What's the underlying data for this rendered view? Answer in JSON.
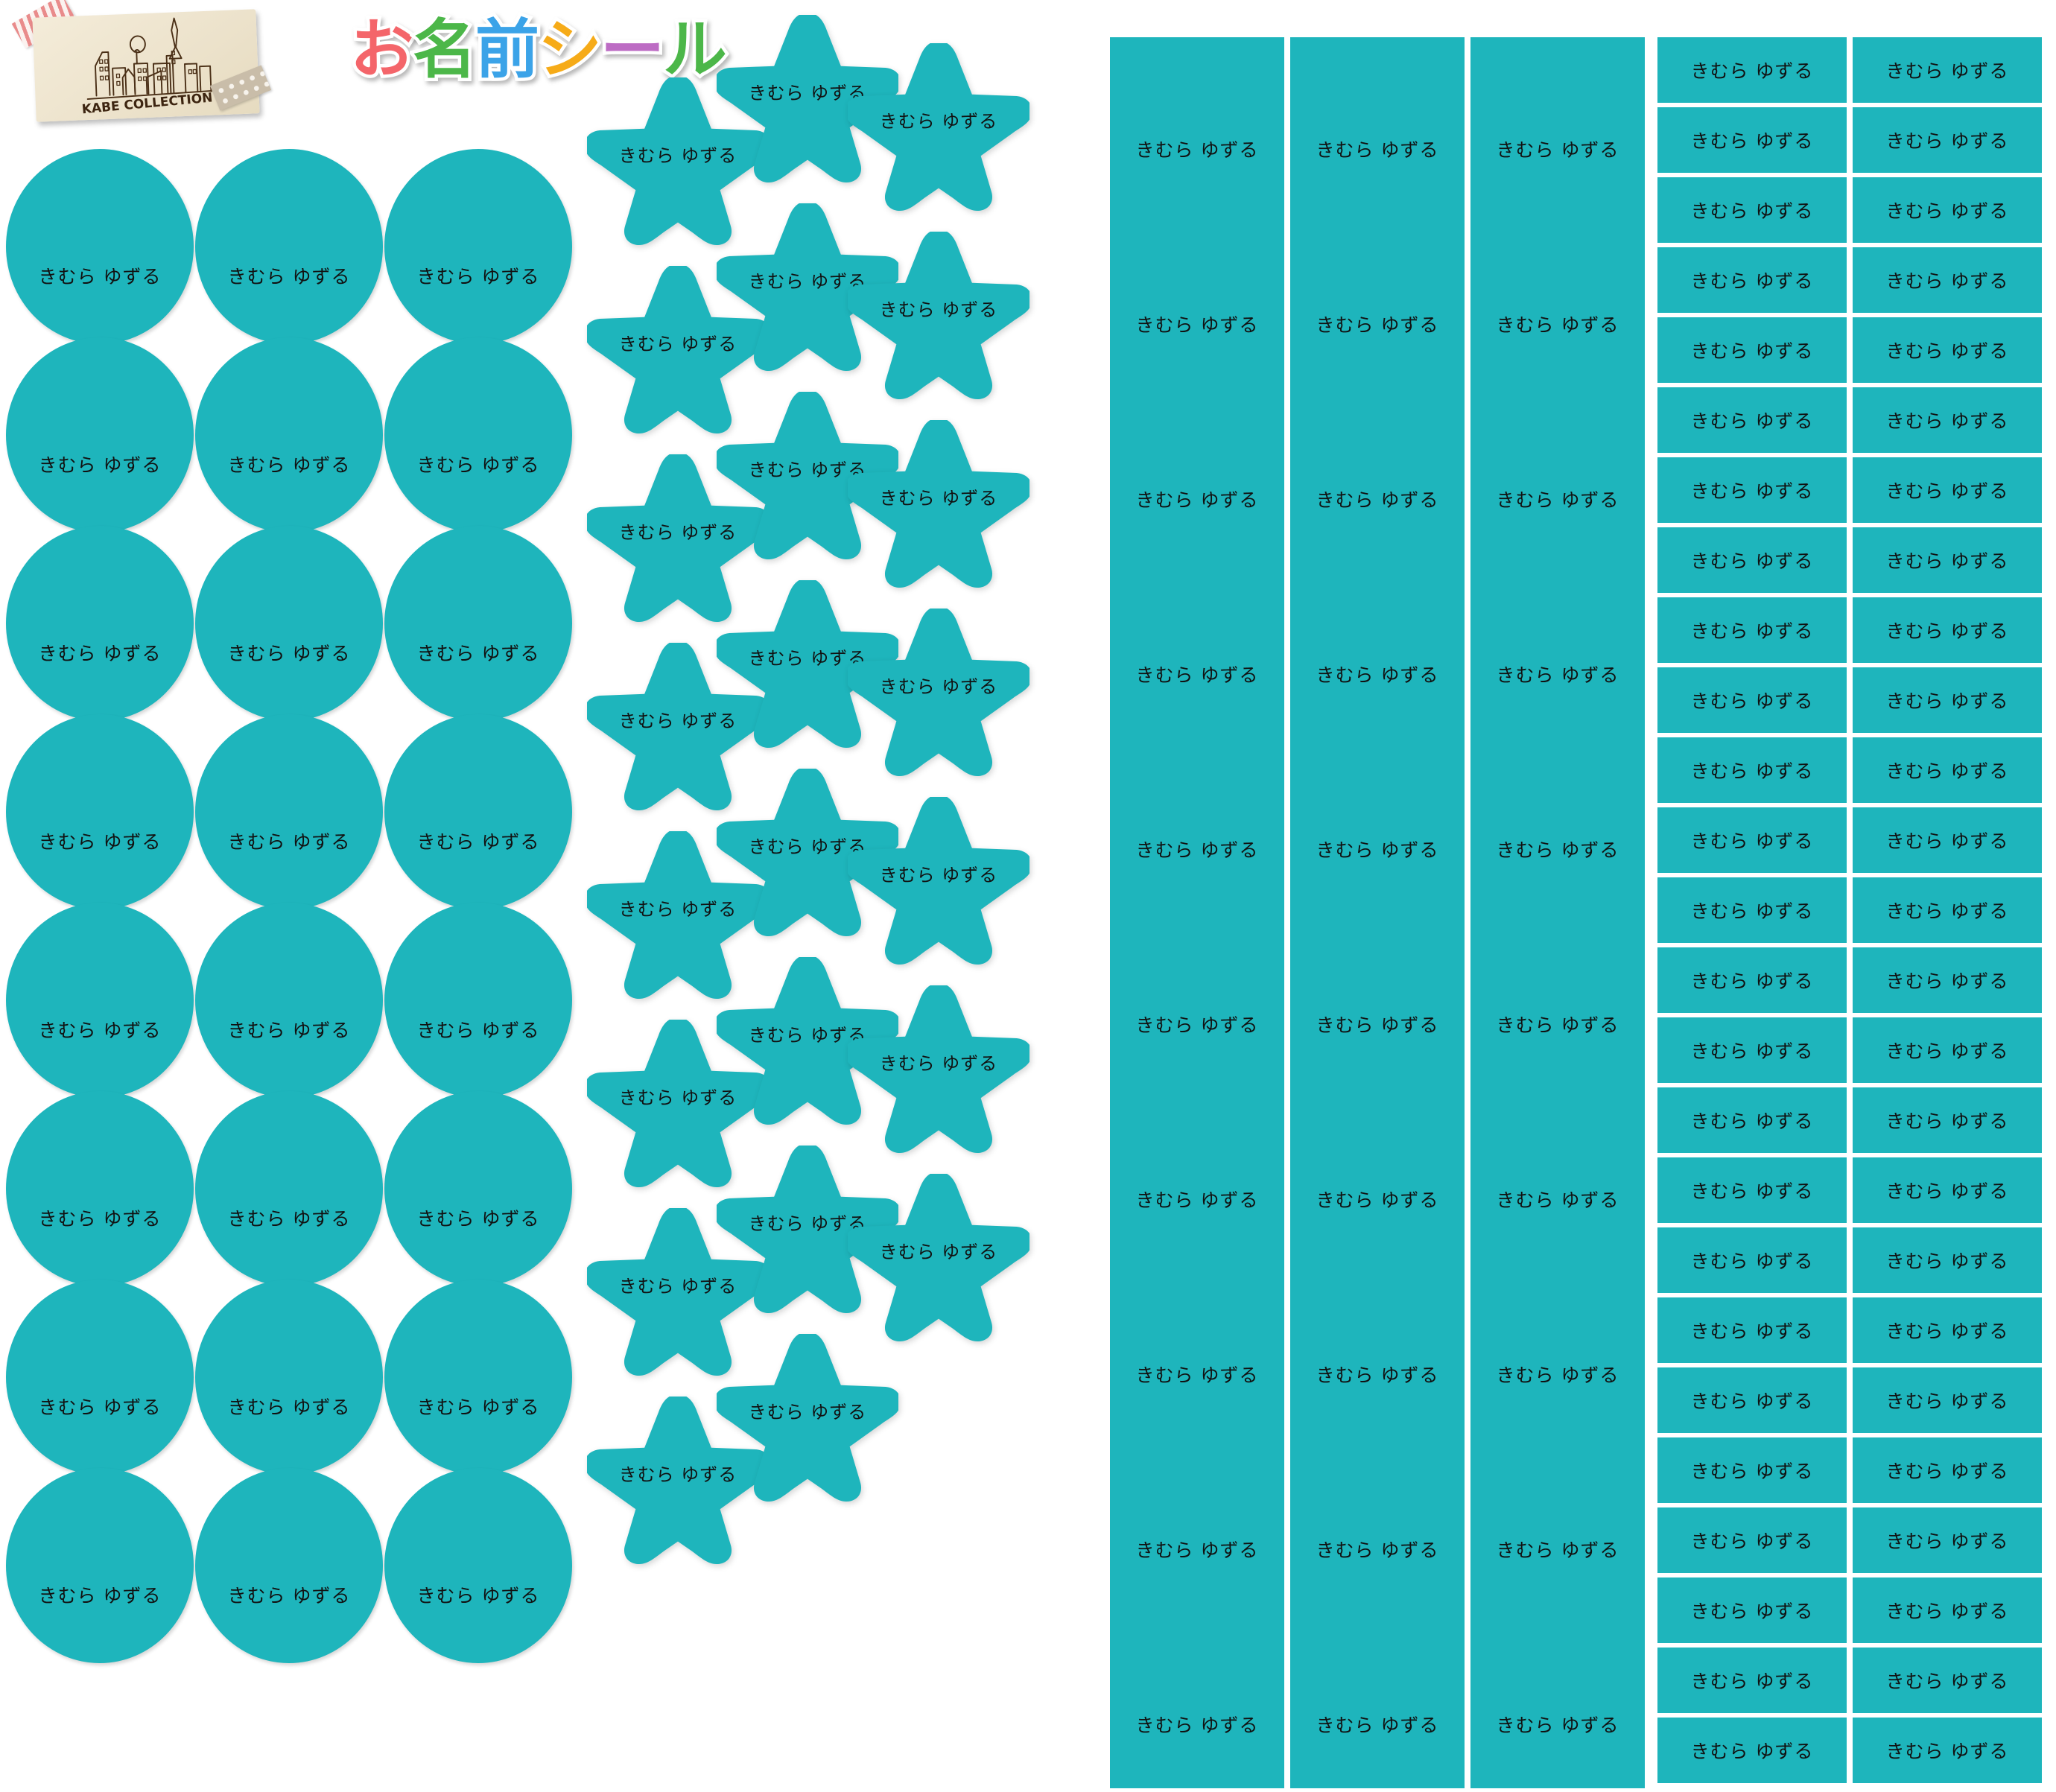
{
  "page": {
    "background": "#ffffff",
    "sticker_color": "#1eb5bc",
    "text_color": "#111111"
  },
  "brand": {
    "logo_text": "KABE COLLECTION",
    "logo_alt": "kabe-collection-city-skyline-sketch"
  },
  "title": {
    "full": "お名前シール",
    "chars": [
      {
        "glyph": "お",
        "color": "#f4656a"
      },
      {
        "glyph": "名",
        "color": "#4cb749"
      },
      {
        "glyph": "前",
        "color": "#3ba3e8"
      },
      {
        "glyph": "シ",
        "color": "#f6ab18"
      },
      {
        "glyph": "ー",
        "color": "#bd6cc4"
      },
      {
        "glyph": "ル",
        "color": "#4cb749"
      }
    ]
  },
  "name_label": "きむら ゆずる",
  "groups": {
    "circles": {
      "label": "circle-stickers",
      "columns": 3,
      "rows": 8,
      "count": 24,
      "shape": "circle"
    },
    "stars": {
      "label": "star-stickers",
      "columns": 3,
      "count": 23,
      "shape": "star"
    },
    "squares": {
      "label": "square-stickers",
      "columns": 3,
      "rows": 10,
      "count": 30,
      "shape": "square"
    },
    "rectangles": {
      "label": "name-strip-stickers",
      "columns": 2,
      "rows": 25,
      "count": 50,
      "shape": "rectangle"
    }
  }
}
